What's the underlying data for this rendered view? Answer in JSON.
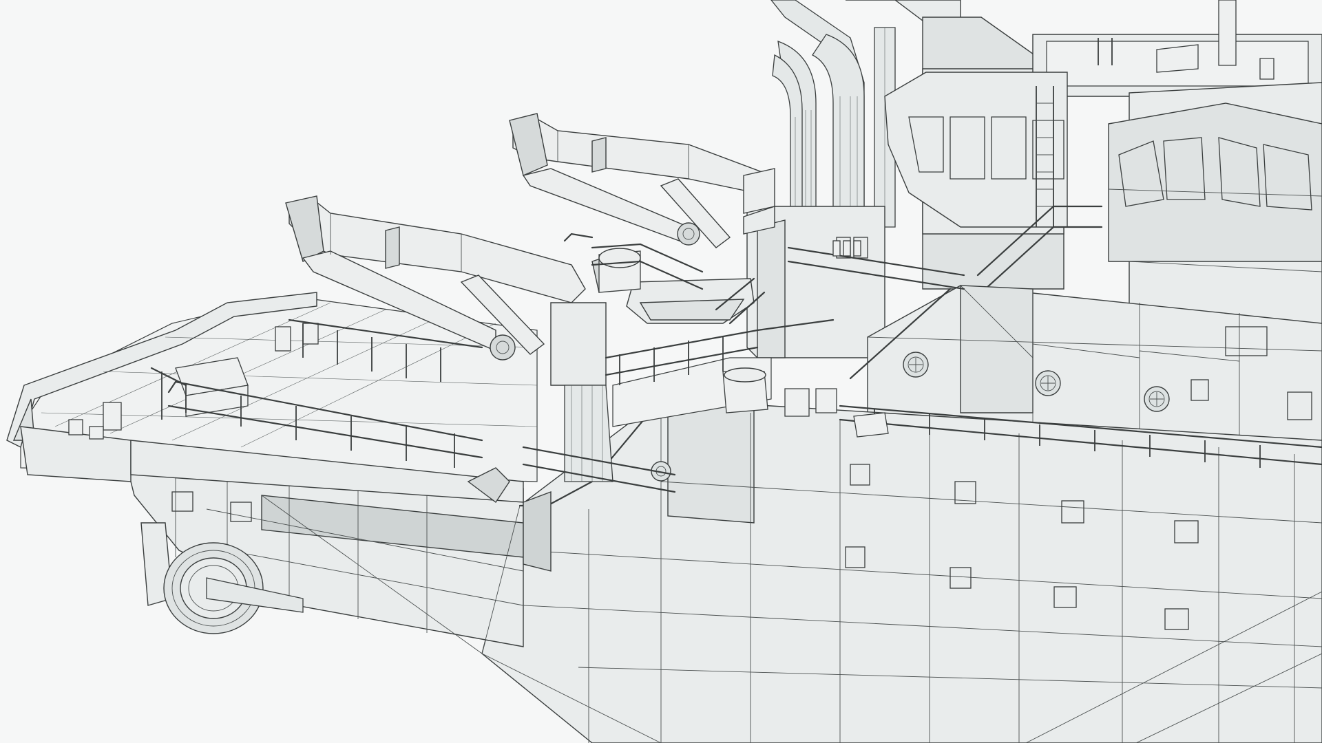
{
  "scene": {
    "description_kind": "wireframe-render",
    "background": "#f6f7f7",
    "surface": "#e9ecec",
    "line": "#3a3e3e"
  }
}
